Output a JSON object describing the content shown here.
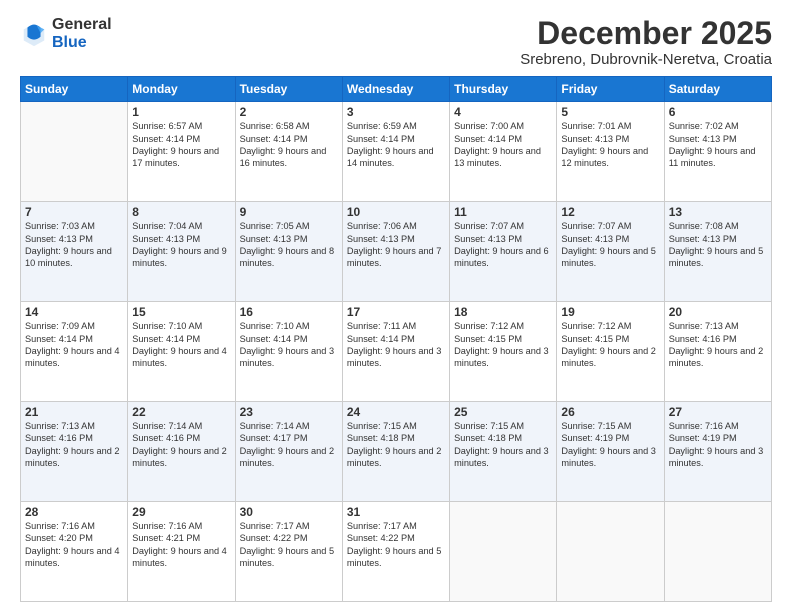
{
  "logo": {
    "general": "General",
    "blue": "Blue"
  },
  "header": {
    "month": "December 2025",
    "location": "Srebreno, Dubrovnik-Neretva, Croatia"
  },
  "weekdays": [
    "Sunday",
    "Monday",
    "Tuesday",
    "Wednesday",
    "Thursday",
    "Friday",
    "Saturday"
  ],
  "weeks": [
    [
      {
        "day": "",
        "sunrise": "",
        "sunset": "",
        "daylight": ""
      },
      {
        "day": "1",
        "sunrise": "Sunrise: 6:57 AM",
        "sunset": "Sunset: 4:14 PM",
        "daylight": "Daylight: 9 hours and 17 minutes."
      },
      {
        "day": "2",
        "sunrise": "Sunrise: 6:58 AM",
        "sunset": "Sunset: 4:14 PM",
        "daylight": "Daylight: 9 hours and 16 minutes."
      },
      {
        "day": "3",
        "sunrise": "Sunrise: 6:59 AM",
        "sunset": "Sunset: 4:14 PM",
        "daylight": "Daylight: 9 hours and 14 minutes."
      },
      {
        "day": "4",
        "sunrise": "Sunrise: 7:00 AM",
        "sunset": "Sunset: 4:14 PM",
        "daylight": "Daylight: 9 hours and 13 minutes."
      },
      {
        "day": "5",
        "sunrise": "Sunrise: 7:01 AM",
        "sunset": "Sunset: 4:13 PM",
        "daylight": "Daylight: 9 hours and 12 minutes."
      },
      {
        "day": "6",
        "sunrise": "Sunrise: 7:02 AM",
        "sunset": "Sunset: 4:13 PM",
        "daylight": "Daylight: 9 hours and 11 minutes."
      }
    ],
    [
      {
        "day": "7",
        "sunrise": "Sunrise: 7:03 AM",
        "sunset": "Sunset: 4:13 PM",
        "daylight": "Daylight: 9 hours and 10 minutes."
      },
      {
        "day": "8",
        "sunrise": "Sunrise: 7:04 AM",
        "sunset": "Sunset: 4:13 PM",
        "daylight": "Daylight: 9 hours and 9 minutes."
      },
      {
        "day": "9",
        "sunrise": "Sunrise: 7:05 AM",
        "sunset": "Sunset: 4:13 PM",
        "daylight": "Daylight: 9 hours and 8 minutes."
      },
      {
        "day": "10",
        "sunrise": "Sunrise: 7:06 AM",
        "sunset": "Sunset: 4:13 PM",
        "daylight": "Daylight: 9 hours and 7 minutes."
      },
      {
        "day": "11",
        "sunrise": "Sunrise: 7:07 AM",
        "sunset": "Sunset: 4:13 PM",
        "daylight": "Daylight: 9 hours and 6 minutes."
      },
      {
        "day": "12",
        "sunrise": "Sunrise: 7:07 AM",
        "sunset": "Sunset: 4:13 PM",
        "daylight": "Daylight: 9 hours and 5 minutes."
      },
      {
        "day": "13",
        "sunrise": "Sunrise: 7:08 AM",
        "sunset": "Sunset: 4:13 PM",
        "daylight": "Daylight: 9 hours and 5 minutes."
      }
    ],
    [
      {
        "day": "14",
        "sunrise": "Sunrise: 7:09 AM",
        "sunset": "Sunset: 4:14 PM",
        "daylight": "Daylight: 9 hours and 4 minutes."
      },
      {
        "day": "15",
        "sunrise": "Sunrise: 7:10 AM",
        "sunset": "Sunset: 4:14 PM",
        "daylight": "Daylight: 9 hours and 4 minutes."
      },
      {
        "day": "16",
        "sunrise": "Sunrise: 7:10 AM",
        "sunset": "Sunset: 4:14 PM",
        "daylight": "Daylight: 9 hours and 3 minutes."
      },
      {
        "day": "17",
        "sunrise": "Sunrise: 7:11 AM",
        "sunset": "Sunset: 4:14 PM",
        "daylight": "Daylight: 9 hours and 3 minutes."
      },
      {
        "day": "18",
        "sunrise": "Sunrise: 7:12 AM",
        "sunset": "Sunset: 4:15 PM",
        "daylight": "Daylight: 9 hours and 3 minutes."
      },
      {
        "day": "19",
        "sunrise": "Sunrise: 7:12 AM",
        "sunset": "Sunset: 4:15 PM",
        "daylight": "Daylight: 9 hours and 2 minutes."
      },
      {
        "day": "20",
        "sunrise": "Sunrise: 7:13 AM",
        "sunset": "Sunset: 4:16 PM",
        "daylight": "Daylight: 9 hours and 2 minutes."
      }
    ],
    [
      {
        "day": "21",
        "sunrise": "Sunrise: 7:13 AM",
        "sunset": "Sunset: 4:16 PM",
        "daylight": "Daylight: 9 hours and 2 minutes."
      },
      {
        "day": "22",
        "sunrise": "Sunrise: 7:14 AM",
        "sunset": "Sunset: 4:16 PM",
        "daylight": "Daylight: 9 hours and 2 minutes."
      },
      {
        "day": "23",
        "sunrise": "Sunrise: 7:14 AM",
        "sunset": "Sunset: 4:17 PM",
        "daylight": "Daylight: 9 hours and 2 minutes."
      },
      {
        "day": "24",
        "sunrise": "Sunrise: 7:15 AM",
        "sunset": "Sunset: 4:18 PM",
        "daylight": "Daylight: 9 hours and 2 minutes."
      },
      {
        "day": "25",
        "sunrise": "Sunrise: 7:15 AM",
        "sunset": "Sunset: 4:18 PM",
        "daylight": "Daylight: 9 hours and 3 minutes."
      },
      {
        "day": "26",
        "sunrise": "Sunrise: 7:15 AM",
        "sunset": "Sunset: 4:19 PM",
        "daylight": "Daylight: 9 hours and 3 minutes."
      },
      {
        "day": "27",
        "sunrise": "Sunrise: 7:16 AM",
        "sunset": "Sunset: 4:19 PM",
        "daylight": "Daylight: 9 hours and 3 minutes."
      }
    ],
    [
      {
        "day": "28",
        "sunrise": "Sunrise: 7:16 AM",
        "sunset": "Sunset: 4:20 PM",
        "daylight": "Daylight: 9 hours and 4 minutes."
      },
      {
        "day": "29",
        "sunrise": "Sunrise: 7:16 AM",
        "sunset": "Sunset: 4:21 PM",
        "daylight": "Daylight: 9 hours and 4 minutes."
      },
      {
        "day": "30",
        "sunrise": "Sunrise: 7:17 AM",
        "sunset": "Sunset: 4:22 PM",
        "daylight": "Daylight: 9 hours and 5 minutes."
      },
      {
        "day": "31",
        "sunrise": "Sunrise: 7:17 AM",
        "sunset": "Sunset: 4:22 PM",
        "daylight": "Daylight: 9 hours and 5 minutes."
      },
      {
        "day": "",
        "sunrise": "",
        "sunset": "",
        "daylight": ""
      },
      {
        "day": "",
        "sunrise": "",
        "sunset": "",
        "daylight": ""
      },
      {
        "day": "",
        "sunrise": "",
        "sunset": "",
        "daylight": ""
      }
    ]
  ]
}
